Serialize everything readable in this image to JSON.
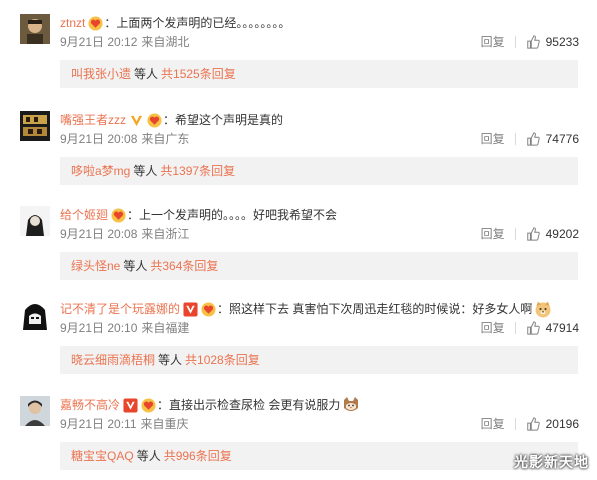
{
  "colors": {
    "username": "#eb7350",
    "meta": "#808080",
    "text": "#333333",
    "reply_bg": "#f2f2f2"
  },
  "comments": [
    {
      "username": "ztnzt",
      "badges": [
        "vip-heart-badge"
      ],
      "text": "：上面两个发声明的已经。。。。。。。。",
      "date": "9月21日 20:12",
      "source": "来自湖北",
      "reply_label": "回复",
      "likes": "95233",
      "reply_user": "叫我张小遗",
      "reply_mid": "等人",
      "reply_count": "共1525条回复"
    },
    {
      "username": "嘴强王者zzz",
      "badges": [
        "verified-v-badge",
        "vip-heart-badge"
      ],
      "text": "：希望这个声明是真的",
      "date": "9月21日 20:08",
      "source": "来自广东",
      "reply_label": "回复",
      "likes": "74776",
      "reply_user": "哆啦a梦mg",
      "reply_mid": "等人",
      "reply_count": "共1397条回复"
    },
    {
      "username": "给个姬廻",
      "badges": [
        "vip-heart-badge"
      ],
      "text": "：上一个发声明的。。。。好吧我希望不会",
      "date": "9月21日 20:08",
      "source": "来自浙江",
      "reply_label": "回复",
      "likes": "49202",
      "reply_user": "绿头怪ne",
      "reply_mid": "等人",
      "reply_count": "共364条回复"
    },
    {
      "username": "记不清了是个玩露娜的",
      "badges": [
        "verified-v-badge",
        "vip-heart-badge"
      ],
      "text": "：照这样下去 真害怕下次周迅走红毯的时候说：好多女人啊",
      "emoji": "doge-emoji",
      "date": "9月21日 20:10",
      "source": "来自福建",
      "reply_label": "回复",
      "likes": "47914",
      "reply_user": "晓云细雨滴梧桐",
      "reply_mid": "等人",
      "reply_count": "共1028条回复"
    },
    {
      "username": "嘉畅不高冷",
      "badges": [
        "verified-v-badge",
        "vip-heart-badge"
      ],
      "text": "：直接出示检查尿检 会更有说服力",
      "emoji": "cat-emoji",
      "date": "9月21日 20:11",
      "source": "来自重庆",
      "reply_label": "回复",
      "likes": "20196",
      "reply_user": "糖宝宝QAQ",
      "reply_mid": "等人",
      "reply_count": "共996条回复"
    }
  ],
  "watermark": "光影新天地"
}
